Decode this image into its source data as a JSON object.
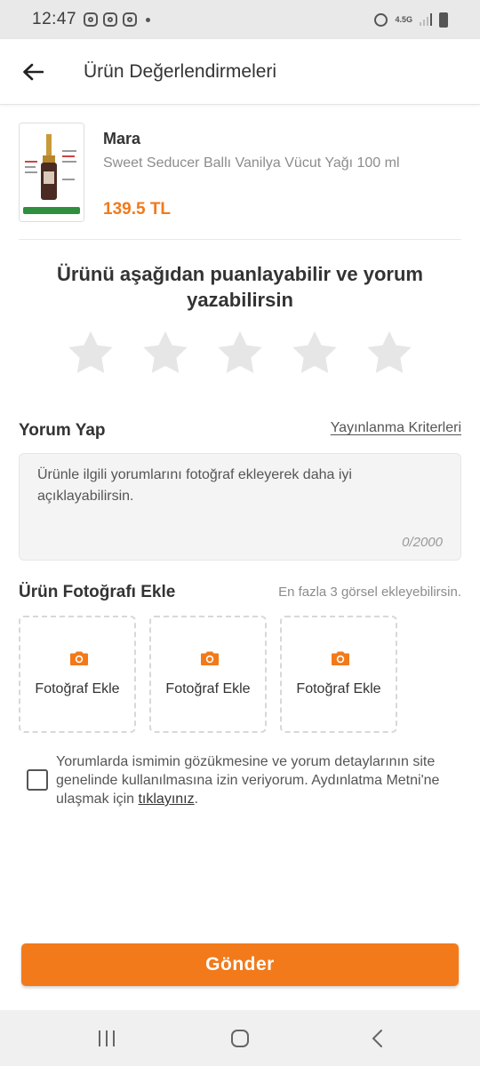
{
  "status_bar": {
    "time": "12:47",
    "network": "4.5G"
  },
  "header": {
    "title": "Ürün Değerlendirmeleri"
  },
  "product": {
    "brand": "Mara",
    "name": "Sweet Seducer Ballı Vanilya Vücut Yağı 100 ml",
    "price": "139.5 TL"
  },
  "rating": {
    "prompt": "Ürünü aşağıdan puanlayabilir ve yorum yazabilirsin",
    "max_stars": 5,
    "selected_stars": 0
  },
  "comment": {
    "title": "Yorum Yap",
    "criteria_link": "Yayınlanma Kriterleri",
    "placeholder": "Ürünle ilgili yorumlarını fotoğraf ekleyerek daha iyi açıklayabilirsin.",
    "counter": "0/2000"
  },
  "photos": {
    "title": "Ürün Fotoğrafı Ekle",
    "hint": "En fazla 3 görsel ekleyebilirsin.",
    "slots": [
      {
        "label": "Fotoğraf Ekle"
      },
      {
        "label": "Fotoğraf Ekle"
      },
      {
        "label": "Fotoğraf Ekle"
      }
    ]
  },
  "consent": {
    "text": "Yorumlarda ismimin gözükmesine ve yorum detaylarının site genelinde kullanılmasına izin veriyorum. Aydınlatma Metni'ne ulaşmak için ",
    "link": "tıklayınız",
    "suffix": ".",
    "checked": false
  },
  "submit": {
    "label": "Gönder"
  },
  "colors": {
    "accent": "#f27a1a",
    "star_empty": "#e6e6e6"
  }
}
